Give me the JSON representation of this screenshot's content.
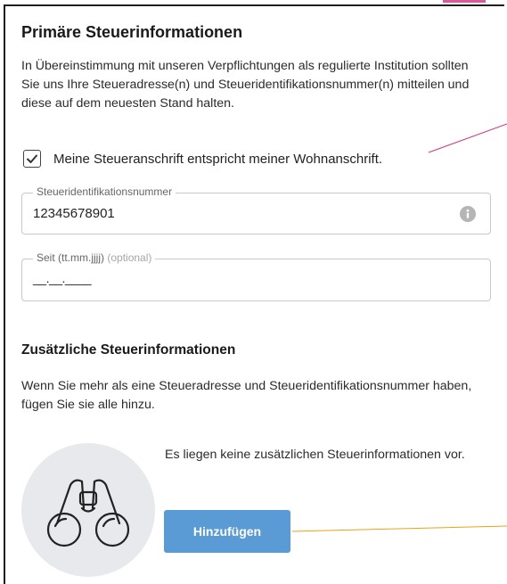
{
  "primary": {
    "title": "Primäre Steuerinformationen",
    "intro": "In Übereinstimmung mit unseren Verpflichtungen als regulierte Institution sollten Sie uns Ihre Steueradresse(n) und Steueridentifikationsnummer(n) mitteilen und diese auf dem neuesten Stand halten.",
    "checkbox_label": "Meine Steueranschrift entspricht meiner Wohnanschrift.",
    "checkbox_checked": true,
    "tin_field": {
      "label": "Steueridentifikationsnummer",
      "value": "12345678901"
    },
    "since_field": {
      "label": "Seit (tt.mm.jjjj)",
      "optional_label": "(optional)",
      "value": "__.__.____"
    }
  },
  "additional": {
    "title": "Zusätzliche Steuerinformationen",
    "description": "Wenn Sie mehr als eine Steueradresse und Steueridentifikationsnummer haben, fügen Sie sie alle hinzu.",
    "empty_state": "Es liegen keine zusätzlichen Steuerinformationen vor.",
    "add_button": "Hinzufügen"
  },
  "colors": {
    "button": "#5b9bd5",
    "annotation_pink": "#d6337a",
    "annotation_orange": "#e8a317",
    "top_accent": "#e0559b"
  },
  "icons": {
    "checkbox": "checkmark-icon",
    "info": "info-icon",
    "empty_state": "binoculars-icon"
  }
}
